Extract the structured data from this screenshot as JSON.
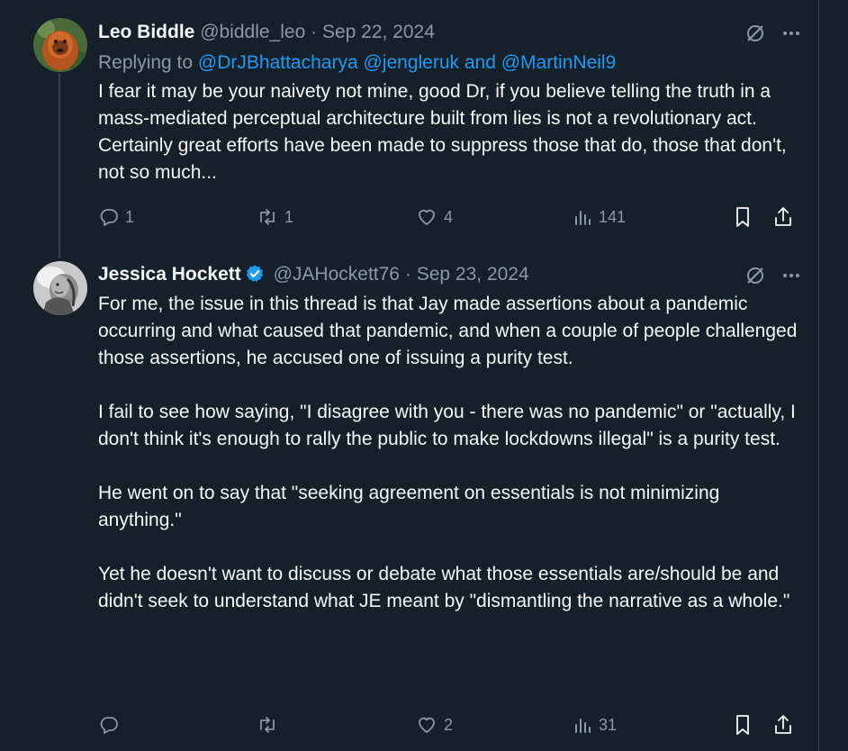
{
  "tweets": [
    {
      "name": "Leo Biddle",
      "handle": "@biddle_leo",
      "dot": "·",
      "date": "Sep 22, 2024",
      "replying_prefix": "Replying to",
      "replying_mentions": "@DrJBhattacharya @jengleruk",
      "replying_and": "and",
      "replying_last": "@MartinNeil9",
      "body": [
        "I fear it may be your naivety not mine, good Dr, if you believe telling the truth in a mass-mediated perceptual architecture built from lies is not a revolutionary act. Certainly great efforts have been made to suppress those that do, those that don't, not so much..."
      ],
      "replies": "1",
      "reposts": "1",
      "likes": "4",
      "views": "141"
    },
    {
      "name": "Jessica Hockett",
      "handle": "@JAHockett76",
      "dot": "·",
      "date": "Sep 23, 2024",
      "body": [
        "For me, the issue in this thread is that Jay made assertions about a pandemic occurring and what caused that pandemic, and when a couple of people challenged those assertions, he accused one of issuing a purity test.",
        "I fail to see how saying, \"I disagree with you - there was no pandemic\" or \"actually, I don't think it's enough to rally the public to make lockdowns illegal\" is a purity test.",
        "He went on to say that \"seeking agreement on essentials is not minimizing anything.\"",
        "Yet he doesn't want to discuss or debate what those essentials are/should be and didn't seek to understand what JE meant by \"dismantling the narrative as a whole.\""
      ],
      "replies": "",
      "reposts": "",
      "likes": "2",
      "views": "31"
    }
  ],
  "colors": {
    "background": "#15202b",
    "text": "#f7f9f9",
    "secondary": "#8b98a5",
    "accent": "#1d9bf0",
    "divider": "#38444d"
  },
  "icons": [
    "grok-icon",
    "more-icon",
    "reply-icon",
    "repost-icon",
    "like-icon",
    "views-icon",
    "bookmark-icon",
    "share-icon",
    "verified-badge-icon"
  ]
}
